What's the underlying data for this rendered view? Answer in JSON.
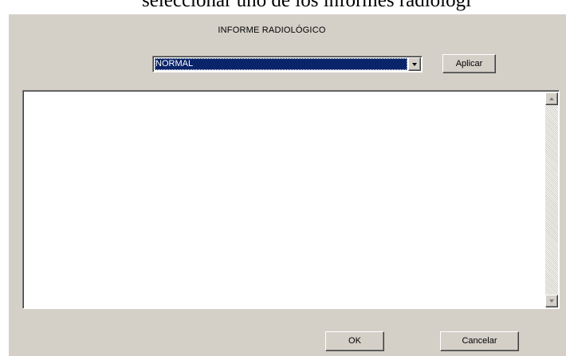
{
  "document": {
    "caption": "seleccionar uno de los informes radiológi"
  },
  "dialog": {
    "title": "INFORME RADIOLÓGICO",
    "report_type": {
      "selected": "NORMAL"
    },
    "apply_label": "Aplicar",
    "report_text": "",
    "ok_label": "OK",
    "cancel_label": "Cancelar"
  },
  "icons": {
    "dropdown": "chevron-down-icon",
    "scroll_up": "scroll-up-arrow-icon",
    "scroll_down": "scroll-down-arrow-icon"
  },
  "colors": {
    "dialog_background": "#d4d0c8",
    "selection_highlight": "#0a246a",
    "selection_text": "#ffffff",
    "field_background": "#ffffff"
  }
}
